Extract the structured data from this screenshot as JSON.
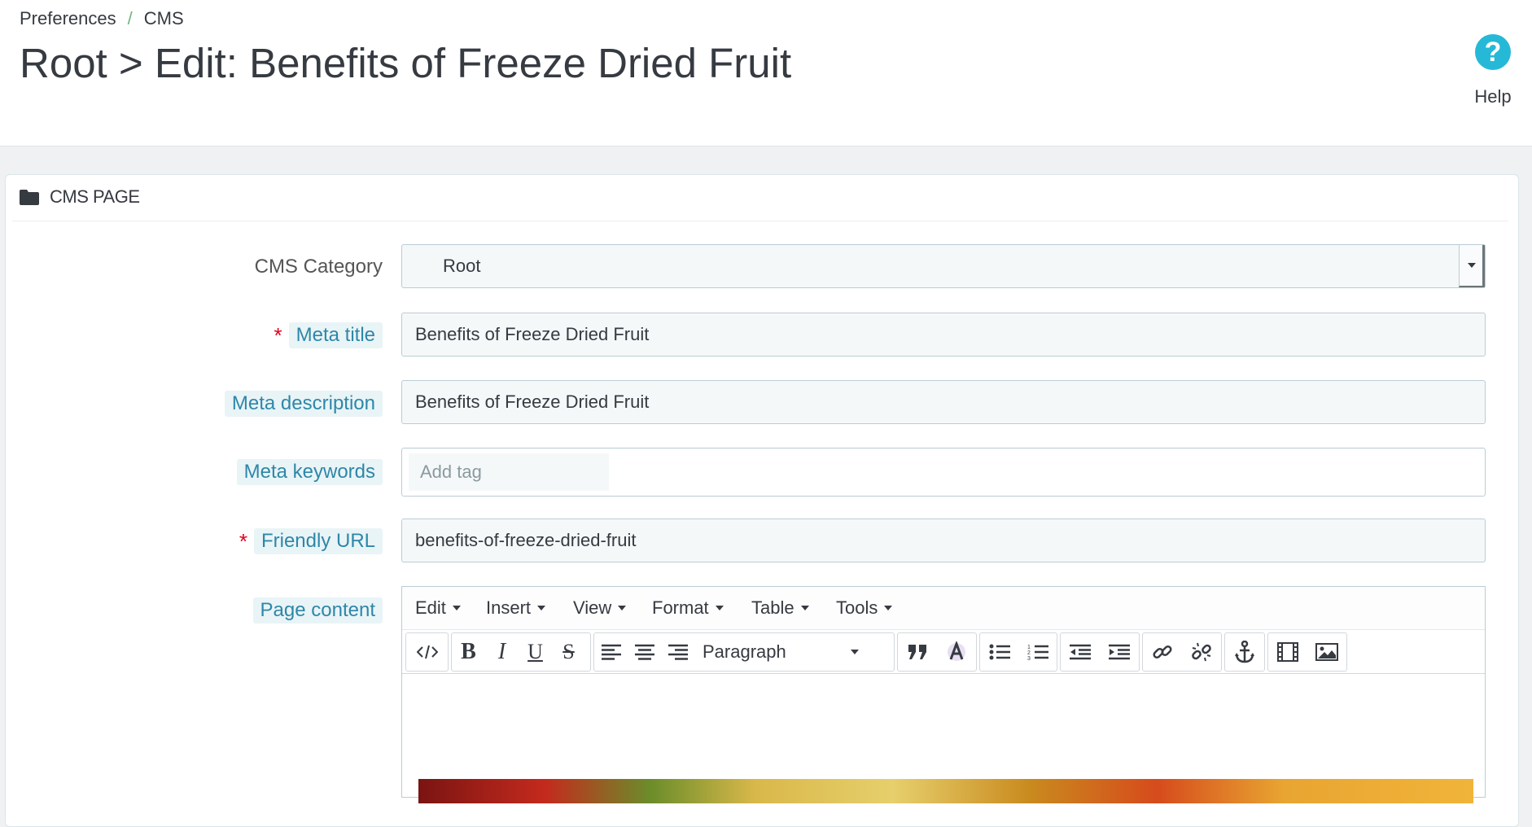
{
  "breadcrumb": {
    "items": [
      "Preferences",
      "CMS"
    ],
    "separator": "/"
  },
  "page_title": "Root > Edit: Benefits of Freeze Dried Fruit",
  "help": {
    "label": "Help",
    "icon": "help-circle-icon"
  },
  "panel": {
    "title": "CMS PAGE",
    "icon": "folder-icon"
  },
  "form": {
    "cms_category": {
      "label": "CMS Category",
      "value": "Root"
    },
    "meta_title": {
      "label": "Meta title",
      "required": "*",
      "value": "Benefits of Freeze Dried Fruit"
    },
    "meta_description": {
      "label": "Meta description",
      "value": "Benefits of Freeze Dried Fruit"
    },
    "meta_keywords": {
      "label": "Meta keywords",
      "placeholder": "Add tag"
    },
    "friendly_url": {
      "label": "Friendly URL",
      "required": "*",
      "value": "benefits-of-freeze-dried-fruit"
    },
    "page_content": {
      "label": "Page content"
    }
  },
  "editor": {
    "menus": [
      "Edit",
      "Insert",
      "View",
      "Format",
      "Table",
      "Tools"
    ],
    "format_select": "Paragraph",
    "toolbar_icons": [
      "source-code-icon",
      "bold-icon",
      "italic-icon",
      "underline-icon",
      "strikethrough-icon",
      "align-left-icon",
      "align-center-icon",
      "align-right-icon",
      "blockquote-icon",
      "text-color-icon",
      "bullet-list-icon",
      "numbered-list-icon",
      "outdent-icon",
      "indent-icon",
      "link-icon",
      "unlink-icon",
      "anchor-icon",
      "media-icon",
      "image-icon"
    ]
  },
  "colors": {
    "accent": "#25b9d7",
    "label_blue": "#2e87a8",
    "required_red": "#e3001b",
    "breadcrumb_sep": "#70b580"
  }
}
